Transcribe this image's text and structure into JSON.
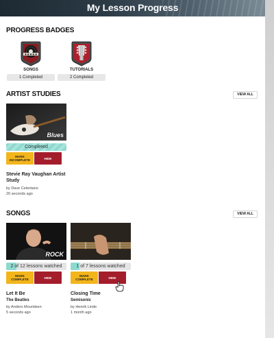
{
  "header": {
    "title": "My Lesson Progress"
  },
  "badges_section": {
    "title": "PROGRESS BADGES",
    "badges": [
      {
        "label": "SONGS",
        "count": "1 Completed",
        "icon": "record-icon"
      },
      {
        "label": "TUTORIALS",
        "count": "2 Completed",
        "icon": "guitar-headstock-icon"
      }
    ]
  },
  "artist_studies": {
    "title": "ARTIST STUDIES",
    "view_all": "VIEW ALL",
    "cards": [
      {
        "tag": "Blues",
        "progress_text": "Completed",
        "completed": true,
        "mark_label": "MARK INCOMPLETE",
        "hide_label": "HIDE",
        "title": "Stevie Ray Vaughan Artist Study",
        "author": "by Dave Celentano",
        "time": "20 seconds ago"
      }
    ]
  },
  "songs": {
    "title": "SONGS",
    "view_all": "VIEW ALL",
    "cards": [
      {
        "tag": "ROCK",
        "progress_text": "2 of 12 lessons watched",
        "progress_fraction": 0.1667,
        "mark_label": "MARK COMPLETE",
        "hide_label": "HIDE",
        "title": "Let It Be",
        "artist": "The Beatles",
        "author": "by Anders Mouridsen",
        "time": "5 seconds ago"
      },
      {
        "tag": "",
        "progress_text": "1 of 7 lessons watched",
        "progress_fraction": 0.1429,
        "mark_label": "MARK COMPLETE",
        "hide_label": "HIDE",
        "title": "Closing Time",
        "artist": "Semisonic",
        "author": "by Henrik Linde",
        "time": "1 month ago"
      }
    ]
  },
  "colors": {
    "mark_button": "#f2b51b",
    "hide_button": "#a41d2b",
    "progress_fill": "#8ed9cf"
  }
}
